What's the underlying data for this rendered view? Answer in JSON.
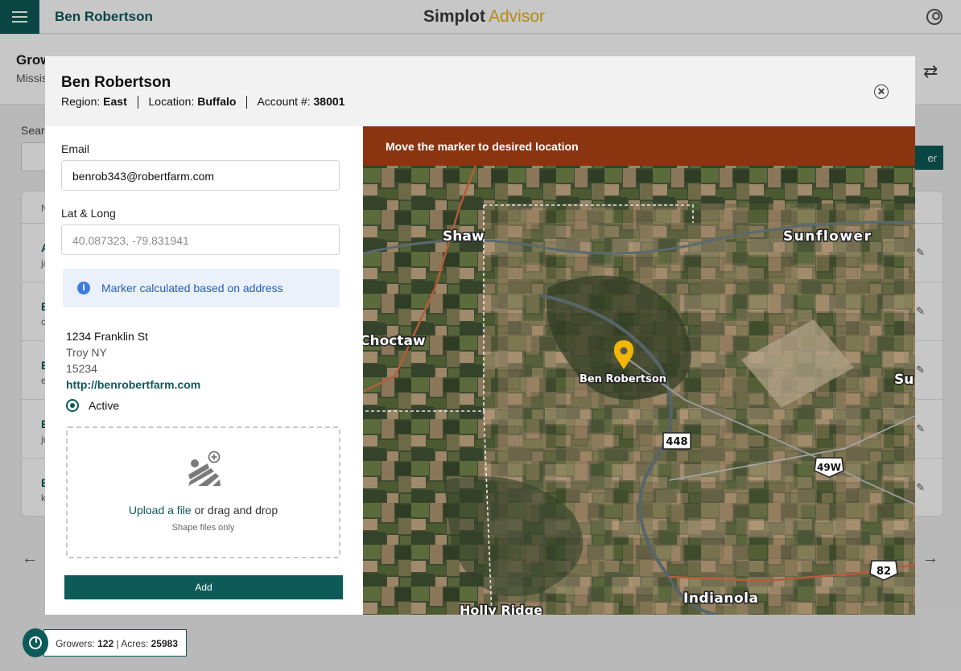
{
  "app": {
    "brand_part1": "Simplot",
    "brand_part2": "Advisor",
    "user_name": "Ben Robertson"
  },
  "page": {
    "title": "Grow",
    "subtitle": "Missis",
    "search_label": "Sear",
    "add_button": "er"
  },
  "table": {
    "header": "N",
    "rows": [
      {
        "name": "A",
        "email": "ja"
      },
      {
        "name": "B",
        "email": "c"
      },
      {
        "name": "B",
        "email": "e"
      },
      {
        "name": "B",
        "email": "ju"
      },
      {
        "name": "B",
        "email": "k"
      }
    ]
  },
  "pager": {
    "prev": "←",
    "next": "→"
  },
  "stats": {
    "growers_label": "Growers:",
    "growers_value": "122",
    "separator": "|",
    "acres_label": "Acres:",
    "acres_value": "25983"
  },
  "modal": {
    "title": "Ben Robertson",
    "region_label": "Region:",
    "region_value": "East",
    "location_label": "Location:",
    "location_value": "Buffalo",
    "account_label": "Account #:",
    "account_value": "38001",
    "form": {
      "email_label": "Email",
      "email_value": "benrob343@robertfarm.com",
      "latlong_label": "Lat & Long",
      "latlong_placeholder": "40.087323, -79.831941",
      "info_text": "Marker calculated based on address",
      "address_line1": "1234 Franklin St",
      "address_line2": "Troy NY",
      "address_line3": "15234",
      "website": "http://benrobertfarm.com",
      "active_label": "Active",
      "upload_link": "Upload a file",
      "upload_rest": " or drag and drop",
      "upload_hint": "Shape files only",
      "add_button": "Add"
    },
    "map": {
      "banner": "Move the marker to desired location",
      "marker_label": "Ben Robertson",
      "places": [
        "Shaw",
        "Sunflower",
        "Choctaw",
        "Su",
        "Indianola",
        "Holly Ridge"
      ],
      "route_shields": [
        "448",
        "49W",
        "82"
      ],
      "marker_color": "#f2b705"
    }
  }
}
